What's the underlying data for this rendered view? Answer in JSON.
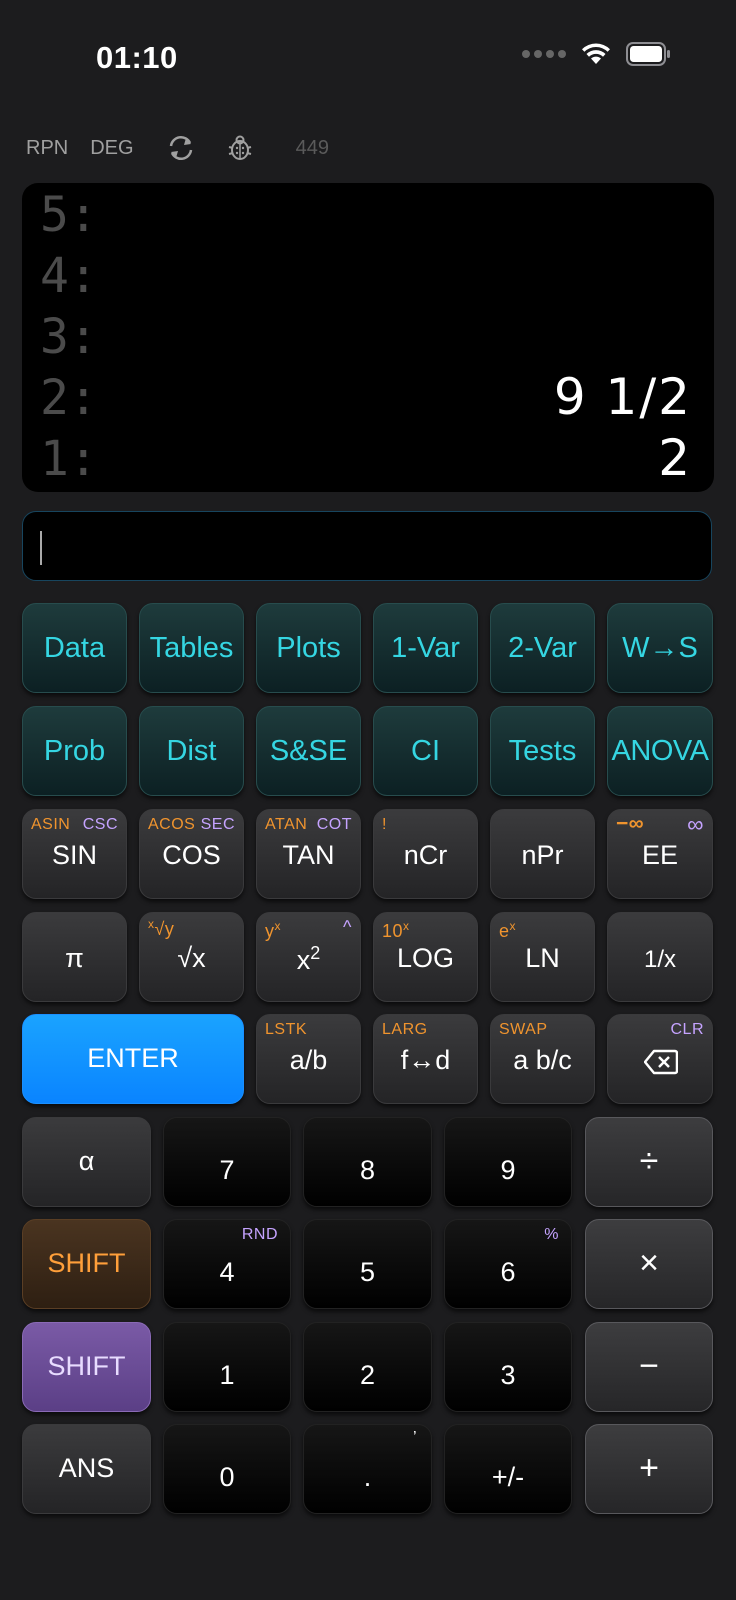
{
  "status": {
    "time": "01:10"
  },
  "modes": {
    "rpn": "RPN",
    "angle": "DEG",
    "count": "449"
  },
  "stack": [
    {
      "label": "5:",
      "value": ""
    },
    {
      "label": "4:",
      "value": ""
    },
    {
      "label": "3:",
      "value": ""
    },
    {
      "label": "2:",
      "value": "9 1/2"
    },
    {
      "label": "1:",
      "value": "2"
    }
  ],
  "entry": {
    "value": ""
  },
  "menu_row1": [
    "Data",
    "Tables",
    "Plots",
    "1-Var",
    "2-Var",
    "W→S"
  ],
  "menu_row2": [
    "Prob",
    "Dist",
    "S&SE",
    "CI",
    "Tests",
    "ANOVA"
  ],
  "trig": {
    "sin": {
      "main": "SIN",
      "shift": "ASIN",
      "alt": "CSC"
    },
    "cos": {
      "main": "COS",
      "shift": "ACOS",
      "alt": "SEC"
    },
    "tan": {
      "main": "TAN",
      "shift": "ATAN",
      "alt": "COT"
    },
    "ncr": {
      "main": "nCr",
      "shift": "!"
    },
    "npr": {
      "main": "nPr"
    },
    "ee": {
      "main": "EE",
      "shift": "−∞",
      "alt": "∞"
    }
  },
  "funcs": {
    "pi": "π",
    "root_main": "√x",
    "root_shift": "y",
    "root_shift_idx": "x",
    "pow_main": "x",
    "pow_main_exp": "2",
    "pow_shift": "y",
    "pow_shift_exp": "x",
    "pow_alt": "^",
    "log_main": "LOG",
    "log_shift": "10",
    "log_shift_exp": "x",
    "ln_main": "LN",
    "ln_shift": "e",
    "ln_shift_exp": "x",
    "inv": "1/x"
  },
  "row5": {
    "enter": "ENTER",
    "frac": {
      "main": "a/b",
      "shift": "LSTK"
    },
    "fd": {
      "main": "f↔d",
      "shift": "LARG"
    },
    "mixed": {
      "main": "a b/c",
      "shift": "SWAP"
    },
    "back_alt": "CLR"
  },
  "keypad": {
    "alpha": "α",
    "shift1": "SHIFT",
    "shift2": "SHIFT",
    "ans": "ANS",
    "n7": "7",
    "n8": "8",
    "n9": "9",
    "n4": "4",
    "n4_alt": "RND",
    "n5": "5",
    "n6": "6",
    "n6_alt": "%",
    "n1": "1",
    "n2": "2",
    "n3": "3",
    "n0": "0",
    "dot": ".",
    "dot_alt": "’",
    "neg": "+/-",
    "div": "÷",
    "mul": "×",
    "sub": "−",
    "add": "+"
  }
}
